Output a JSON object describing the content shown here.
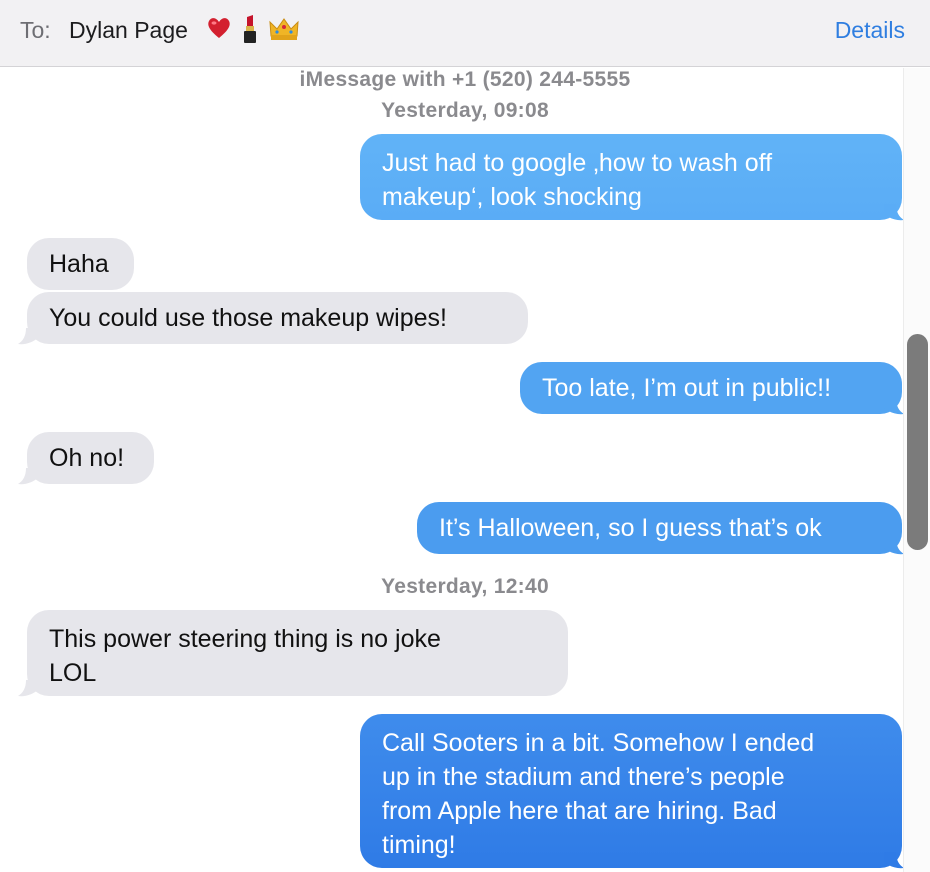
{
  "header": {
    "to_label": "To:",
    "contact_name": "Dylan Page",
    "emojis": [
      "heart-emoji",
      "lipstick-emoji",
      "crown-emoji"
    ],
    "details_label": "Details"
  },
  "thread": {
    "service_line": "iMessage with +1 (520) 244-5555",
    "timestamps": [
      "Yesterday, 09:08",
      "Yesterday, 12:40"
    ],
    "messages": [
      {
        "from": "me",
        "lines": [
          "Just had to google ‚how to wash off",
          "makeup‘, look shocking"
        ]
      },
      {
        "from": "them",
        "lines": [
          "Haha"
        ]
      },
      {
        "from": "them",
        "lines": [
          "You could use those makeup wipes!"
        ]
      },
      {
        "from": "me",
        "lines": [
          "Too late, I’m out in public!!"
        ]
      },
      {
        "from": "them",
        "lines": [
          "Oh no!"
        ]
      },
      {
        "from": "me",
        "lines": [
          "It’s Halloween, so I guess that’s ok"
        ]
      },
      {
        "from": "them",
        "lines": [
          "This power steering thing is no joke",
          "LOL"
        ]
      },
      {
        "from": "me",
        "lines": [
          "Call Sooters in a bit. Somehow I ended",
          "up in the stadium and there’s people",
          "from Apple here that are hiring. Bad",
          "timing!"
        ]
      }
    ]
  },
  "colors": {
    "outgoing_gradient_top": "#5fb0f6",
    "outgoing_gradient_bottom": "#2f7be6",
    "incoming": "#e6e6eb",
    "accent": "#2f7ee0"
  }
}
